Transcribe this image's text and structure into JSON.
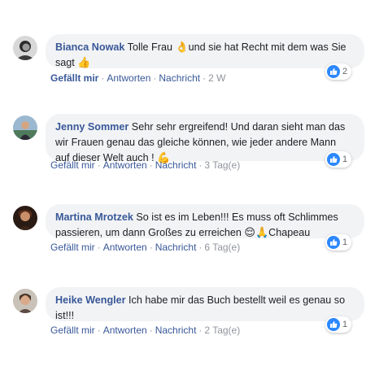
{
  "comments": [
    {
      "author": "Bianca Nowak",
      "text_a": " Tolle Frau ",
      "emoji_a": "👌",
      "text_b": "und sie hat Recht mit dem was Sie sagt ",
      "emoji_b": "👍",
      "text_c": "",
      "actions": {
        "like": "Gefällt mir",
        "reply": "Antworten",
        "message": "Nachricht",
        "time": "2 W"
      },
      "reactions": {
        "icon": "like-icon",
        "count": "2"
      }
    },
    {
      "author": "Jenny Sommer",
      "text_a": " Sehr sehr ergreifend! Und daran sieht man das wir Frauen genau das gleiche können, wie jeder andere Mann auf dieser Welt auch ! ",
      "emoji_a": "💪",
      "text_b": "",
      "emoji_b": "",
      "text_c": "",
      "actions": {
        "like": "Gefällt mir",
        "reply": "Antworten",
        "message": "Nachricht",
        "time": "3 Tag(e)"
      },
      "reactions": {
        "icon": "like-icon",
        "count": "1"
      }
    },
    {
      "author": "Martina Mrotzek",
      "text_a": " So ist es im Leben!!! Es muss oft Schlimmes passieren, um dann Großes zu erreichen ",
      "emoji_a": "😌",
      "text_b": "",
      "emoji_b": "🙏",
      "text_c": "Chapeau",
      "actions": {
        "like": "Gefällt mir",
        "reply": "Antworten",
        "message": "Nachricht",
        "time": "6 Tag(e)"
      },
      "reactions": {
        "icon": "like-icon",
        "count": "1"
      }
    },
    {
      "author": "Heike Wengler",
      "text_a": " Ich habe mir das Buch bestellt weil es genau so ist!!!",
      "emoji_a": "",
      "text_b": "",
      "emoji_b": "",
      "text_c": "",
      "actions": {
        "like": "Gefällt mir",
        "reply": "Antworten",
        "message": "Nachricht",
        "time": "2 Tag(e)"
      },
      "reactions": {
        "icon": "like-icon",
        "count": "1"
      }
    }
  ],
  "colors": {
    "link": "#385898",
    "bubble": "#f2f3f5",
    "like_blue": "#2d88ff",
    "timestamp": "#90949c"
  }
}
